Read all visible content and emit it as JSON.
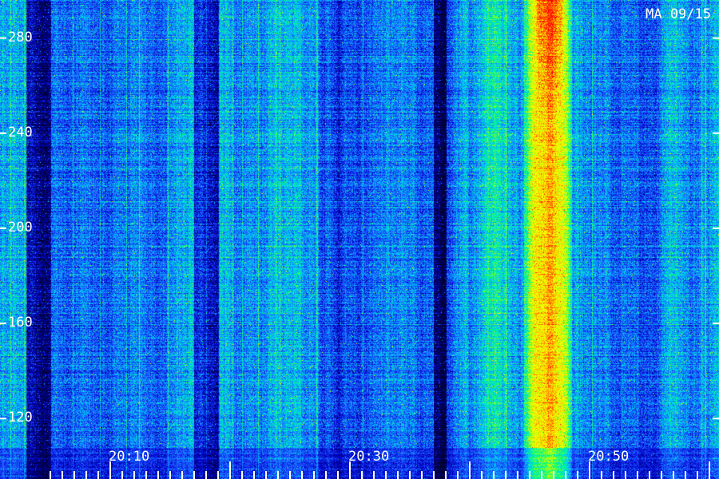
{
  "stamp": "MA 09/15",
  "chart_data": {
    "type": "heatmap",
    "title": "",
    "xlabel": "",
    "ylabel": "",
    "x_ticks": [
      "20:10",
      "20:30",
      "20:50"
    ],
    "y_ticks": [
      120,
      160,
      200,
      240,
      280
    ],
    "ylim": [
      108,
      296
    ],
    "colormap": [
      "#000033",
      "#0000c8",
      "#1e50ff",
      "#00c8ff",
      "#00ff80",
      "#c8ff00",
      "#ffff00",
      "#ff8000",
      "#ff0000"
    ],
    "features": [
      {
        "kind": "bright-vertical-band",
        "from": "20:45",
        "to": "20:48",
        "level": "high"
      },
      {
        "kind": "dark-vertical-band",
        "from": "20:03",
        "to": "20:05",
        "level": "low"
      },
      {
        "kind": "dark-vertical-band",
        "from": "20:17",
        "to": "20:19",
        "level": "low"
      },
      {
        "kind": "dark-vertical-band",
        "from": "20:37",
        "to": "20:38",
        "level": "low"
      }
    ]
  }
}
